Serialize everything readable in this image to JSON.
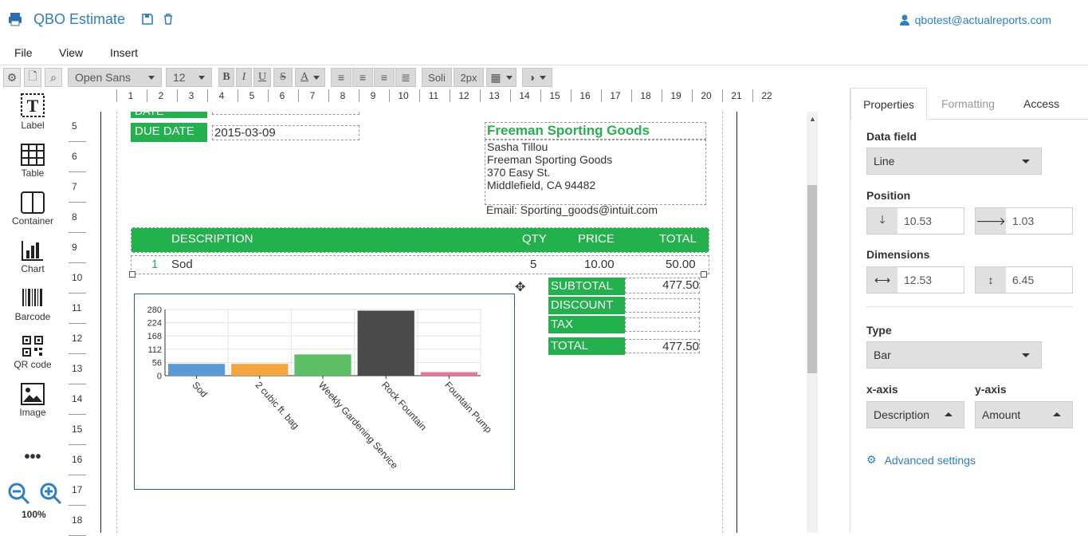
{
  "app": {
    "title": "QBO Estimate",
    "user": "qbotest@actualreports.com"
  },
  "menu": [
    "File",
    "View",
    "Insert"
  ],
  "toolbar": {
    "font": "Open Sans",
    "size": "12",
    "style": "Soli",
    "stroke": "2px"
  },
  "palette": [
    {
      "label": "Label"
    },
    {
      "label": "Table"
    },
    {
      "label": "Container"
    },
    {
      "label": "Chart"
    },
    {
      "label": "Barcode"
    },
    {
      "label": "QR code"
    },
    {
      "label": "Image"
    }
  ],
  "zoom": "100%",
  "ruler": [
    "1",
    "2",
    "3",
    "4",
    "5",
    "6",
    "7",
    "8",
    "9",
    "10",
    "11",
    "12",
    "13",
    "14",
    "15",
    "16",
    "17",
    "18",
    "19",
    "20",
    "21",
    "22"
  ],
  "vruler": [
    "5",
    "6",
    "7",
    "8",
    "9",
    "10",
    "11",
    "12",
    "13",
    "14",
    "15",
    "16",
    "17",
    "18"
  ],
  "doc": {
    "date_label": "DATE",
    "due_label": "DUE DATE",
    "due_value": "2015-03-09",
    "company": "Freeman Sporting Goods",
    "addr1": "Sasha Tillou",
    "addr2": "Freeman Sporting Goods",
    "addr3": "370 Easy St.",
    "addr4": "Middlefield, CA 94482",
    "email": "Email: Sporting_goods@intuit.com",
    "th_desc": "DESCRIPTION",
    "th_qty": "QTY",
    "th_price": "PRICE",
    "th_total": "TOTAL",
    "row_num": "1",
    "row_desc": "Sod",
    "row_qty": "5",
    "row_price": "10.00",
    "row_total": "50.00",
    "subtotal_label": "SUBTOTAL",
    "subtotal_value": "477.50",
    "discount_label": "DISCOUNT",
    "discount_value": "",
    "tax_label": "TAX",
    "tax_value": "",
    "total_label": "TOTAL",
    "total_value": "477.50"
  },
  "chart_data": {
    "type": "bar",
    "categories": [
      "Sod",
      "2 cubic ft. bag",
      "Weekly Gardening Service",
      "Rock Fountain",
      "Fountain Pump"
    ],
    "values": [
      50,
      50,
      90,
      275,
      15
    ],
    "colors": [
      "#5b9bd5",
      "#f4a540",
      "#5cbf63",
      "#4a4a4a",
      "#e8749c"
    ],
    "yticks": [
      "0",
      "56",
      "112",
      "168",
      "224",
      "280"
    ],
    "ylim": [
      0,
      280
    ]
  },
  "panel": {
    "tabs": [
      "Properties",
      "Formatting",
      "Access"
    ],
    "data_field_label": "Data field",
    "data_field": "Line",
    "position_label": "Position",
    "pos_y": "10.53",
    "pos_x": "1.03",
    "dimensions_label": "Dimensions",
    "width": "12.53",
    "height": "6.45",
    "type_label": "Type",
    "type": "Bar",
    "xaxis_label": "x-axis",
    "xaxis": "Description",
    "yaxis_label": "y-axis",
    "yaxis": "Amount",
    "advanced": "Advanced settings"
  }
}
